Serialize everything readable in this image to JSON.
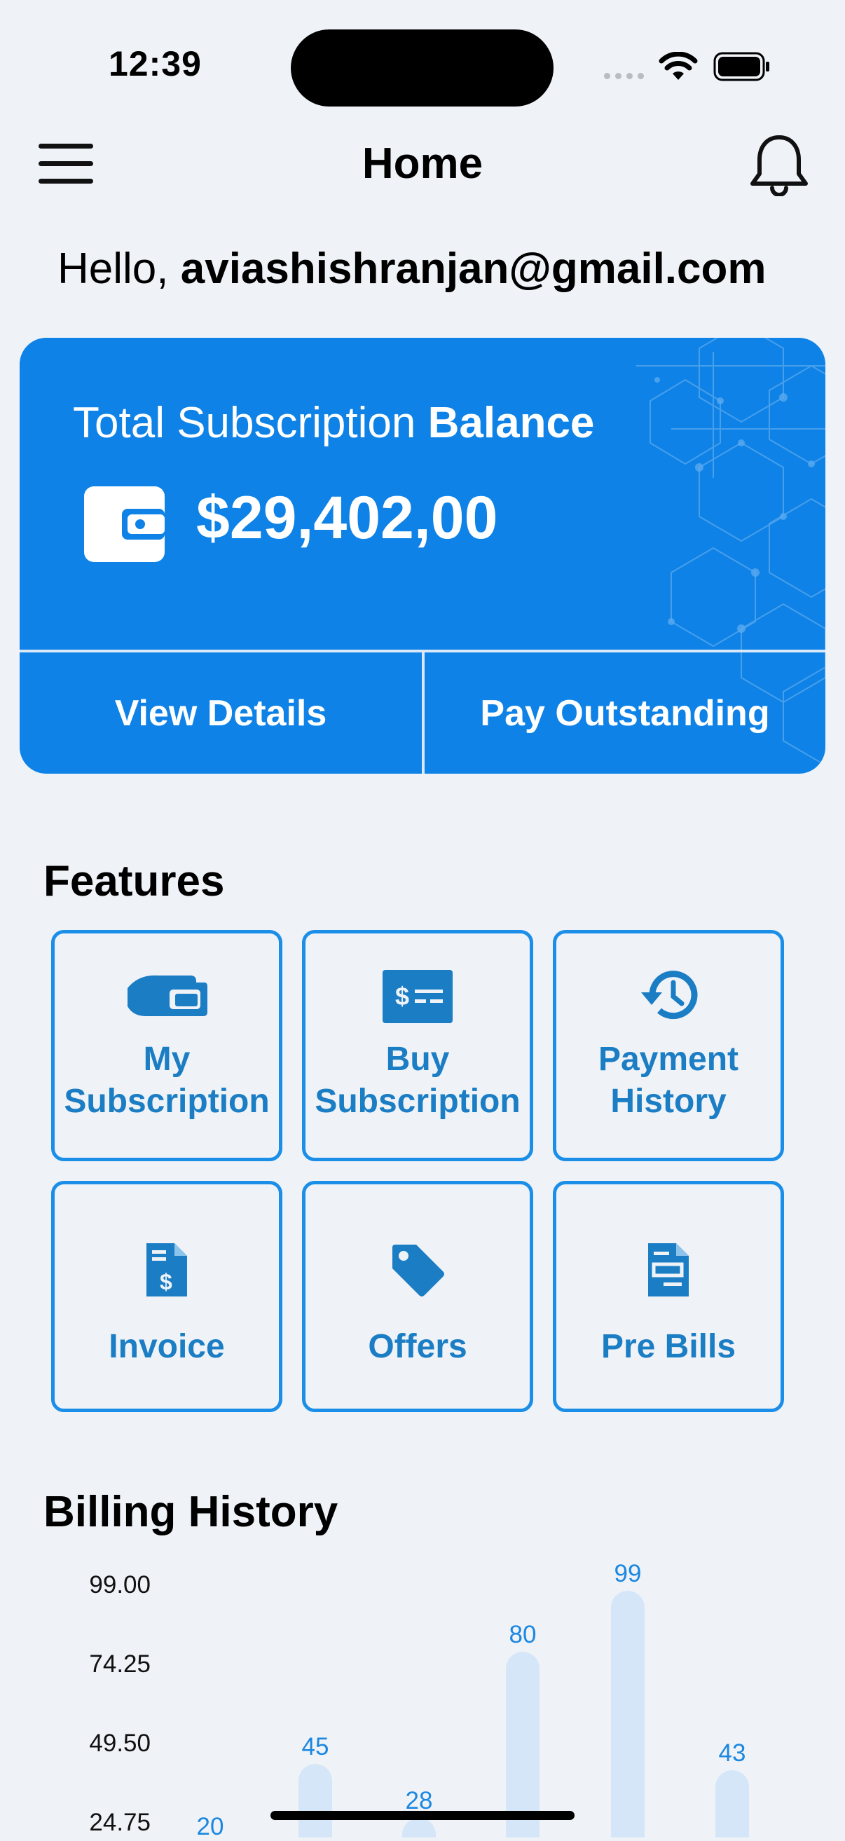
{
  "status_bar": {
    "time": "12:39"
  },
  "header": {
    "title": "Home"
  },
  "greeting": {
    "prefix": "Hello,",
    "email": "aviashishranjan@gmail.com"
  },
  "balance_card": {
    "label_regular": "Total Subscription",
    "label_bold": "Balance",
    "amount": "$29,402,00",
    "view_details": "View Details",
    "pay_outstanding": "Pay Outstanding"
  },
  "features": {
    "title": "Features",
    "items": [
      {
        "line1": "My",
        "line2": "Subscription",
        "icon": "hand-card-icon"
      },
      {
        "line1": "Buy",
        "line2": "Subscription",
        "icon": "dollar-card-icon"
      },
      {
        "line1": "Payment",
        "line2": "History",
        "icon": "history-icon"
      },
      {
        "line1": "Invoice",
        "icon": "invoice-icon"
      },
      {
        "line1": "Offers",
        "icon": "tag-icon"
      },
      {
        "line1": "Pre Bills",
        "icon": "document-icon"
      }
    ]
  },
  "billing": {
    "title": "Billing History"
  },
  "chart_data": {
    "type": "bar",
    "y_ticks": [
      "99.00",
      "74.25",
      "49.50",
      "24.75"
    ],
    "ylim": [
      0,
      99
    ],
    "values": [
      20,
      45,
      28,
      80,
      99,
      43
    ],
    "value_labels": [
      "20",
      "45",
      "28",
      "80",
      "99",
      "43"
    ]
  },
  "colors": {
    "primary": "#0e82e6",
    "tile_border": "#1b8ee8",
    "tile_text": "#1b7dc4",
    "bar": "#d4e6f7",
    "background": "#eff3f8"
  }
}
